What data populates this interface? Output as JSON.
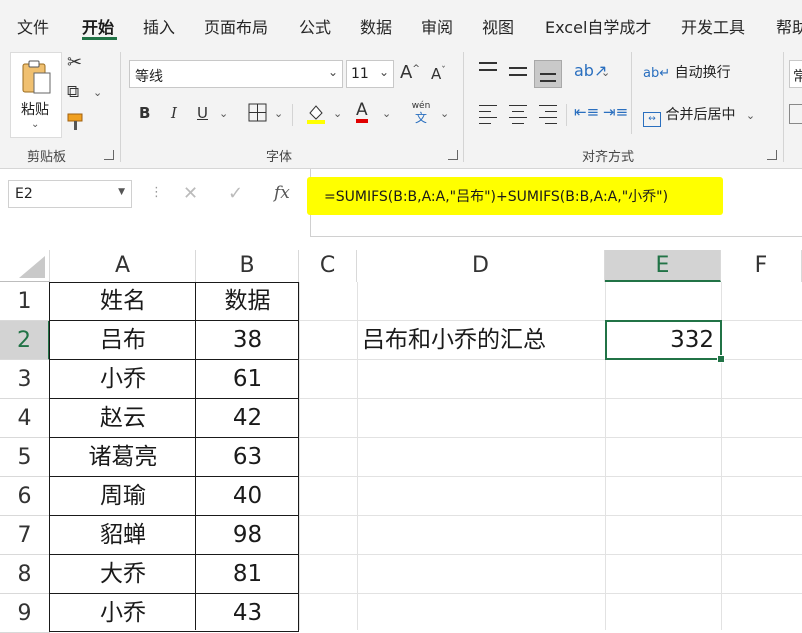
{
  "tabs": [
    {
      "label": "文件"
    },
    {
      "label": "开始"
    },
    {
      "label": "插入"
    },
    {
      "label": "页面布局"
    },
    {
      "label": "公式"
    },
    {
      "label": "数据"
    },
    {
      "label": "审阅"
    },
    {
      "label": "视图"
    },
    {
      "label": "Excel自学成才"
    },
    {
      "label": "开发工具"
    },
    {
      "label": "帮助"
    }
  ],
  "ribbon": {
    "clipboard": {
      "paste_label": "粘贴",
      "group_label": "剪贴板"
    },
    "font": {
      "font_name": "等线",
      "font_size": "11",
      "bold": "B",
      "italic": "I",
      "underline": "U",
      "grow": "A",
      "shrink": "A",
      "font_color_glyph": "A",
      "phonetic_top": "wén",
      "phonetic_bottom": "文",
      "group_label": "字体"
    },
    "alignment": {
      "wrap_label": "自动换行",
      "merge_label": "合并后居中",
      "group_label": "对齐方式"
    },
    "number": {
      "partial_label": "常"
    }
  },
  "formula_bar": {
    "name_box": "E2",
    "fx": "fx",
    "formula": "=SUMIFS(B:B,A:A,\"吕布\")+SUMIFS(B:B,A:A,\"小乔\")",
    "highlight_color": "#ffff00"
  },
  "sheet": {
    "columns": [
      "A",
      "B",
      "C",
      "D",
      "E",
      "F"
    ],
    "rows": [
      "1",
      "2",
      "3",
      "4",
      "5",
      "6",
      "7",
      "8",
      "9"
    ],
    "header": {
      "name": "姓名",
      "data": "数据"
    },
    "records": [
      {
        "name": "吕布",
        "value": "38"
      },
      {
        "name": "小乔",
        "value": "61"
      },
      {
        "name": "赵云",
        "value": "42"
      },
      {
        "name": "诸葛亮",
        "value": "63"
      },
      {
        "name": "周瑜",
        "value": "40"
      },
      {
        "name": "貂蝉",
        "value": "98"
      },
      {
        "name": "大乔",
        "value": "81"
      },
      {
        "name": "小乔",
        "value": "43"
      }
    ],
    "d2_label": "吕布和小乔的汇总",
    "e2_value": "332",
    "accent": "#217346"
  }
}
